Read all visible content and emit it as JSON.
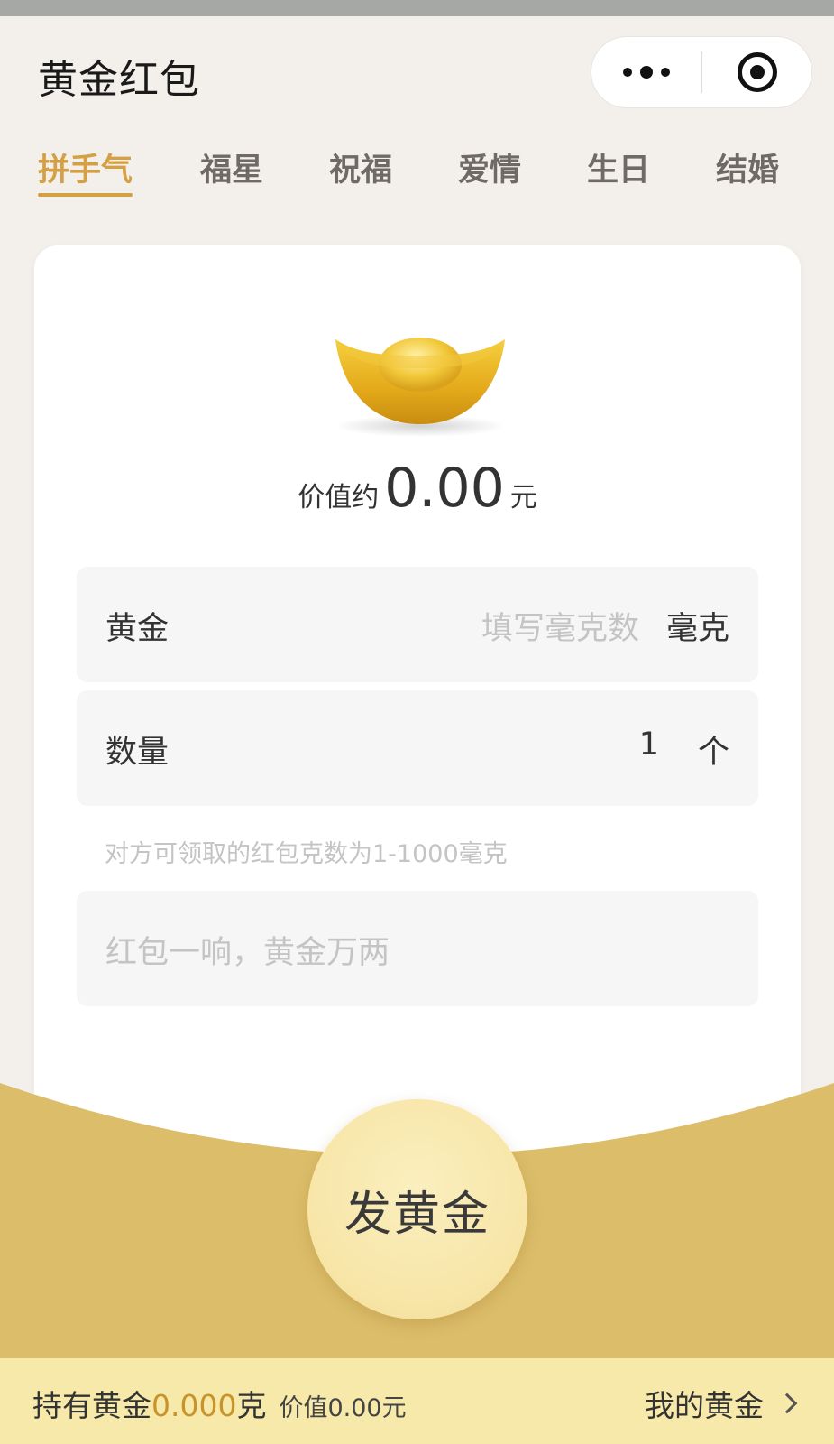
{
  "header": {
    "title": "黄金红包"
  },
  "tabs": [
    {
      "label": "拼手气",
      "active": true
    },
    {
      "label": "福星",
      "active": false
    },
    {
      "label": "祝福",
      "active": false
    },
    {
      "label": "爱情",
      "active": false
    },
    {
      "label": "生日",
      "active": false
    },
    {
      "label": "结婚",
      "active": false
    }
  ],
  "card": {
    "value_prefix": "价值约",
    "value_amount": "0.00",
    "value_unit": "元",
    "gold_field": {
      "label": "黄金",
      "placeholder": "填写毫克数",
      "unit": "毫克"
    },
    "quantity_field": {
      "label": "数量",
      "value": "1",
      "unit": "个"
    },
    "hint": "对方可领取的红包克数为1-1000毫克",
    "message_field": {
      "placeholder": "红包一响，黄金万两"
    }
  },
  "send_button": {
    "label": "发黄金"
  },
  "footer": {
    "holding_prefix": "持有黄金",
    "holding_amount": "0.000",
    "holding_unit": "克",
    "holding_value": "价值0.00元",
    "my_gold_link": "我的黄金"
  },
  "icons": {
    "more": "more-dots-icon",
    "close": "target-icon",
    "ingot": "gold-ingot-icon",
    "chevron": "chevron-right-icon"
  },
  "colors": {
    "accent": "#d4a043",
    "gold_band": "#dcbd6a",
    "footer_bg": "#f7e9a9",
    "button_bg": "#f7e5a6"
  }
}
